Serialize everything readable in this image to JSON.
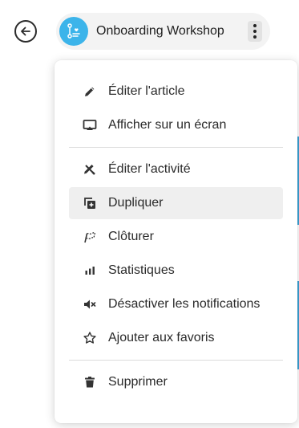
{
  "header": {
    "title": "Onboarding Workshop"
  },
  "menu": {
    "group1": [
      {
        "label": "Éditer l'article",
        "icon": "pencil-icon"
      },
      {
        "label": "Afficher sur un écran",
        "icon": "airplay-screen-icon"
      }
    ],
    "group2": [
      {
        "label": "Éditer l'activité",
        "icon": "edit-activity-icon"
      },
      {
        "label": "Dupliquer",
        "icon": "duplicate-icon",
        "active": true
      },
      {
        "label": "Clôturer",
        "icon": "finish-flag-icon"
      },
      {
        "label": "Statistiques",
        "icon": "bar-chart-icon"
      },
      {
        "label": "Désactiver les notifications",
        "icon": "mute-icon"
      },
      {
        "label": "Ajouter aux favoris",
        "icon": "star-icon"
      }
    ],
    "group3": [
      {
        "label": "Supprimer",
        "icon": "trash-icon"
      }
    ]
  },
  "colors": {
    "accent": "#3cb4ea",
    "active_bg": "#efefef"
  }
}
